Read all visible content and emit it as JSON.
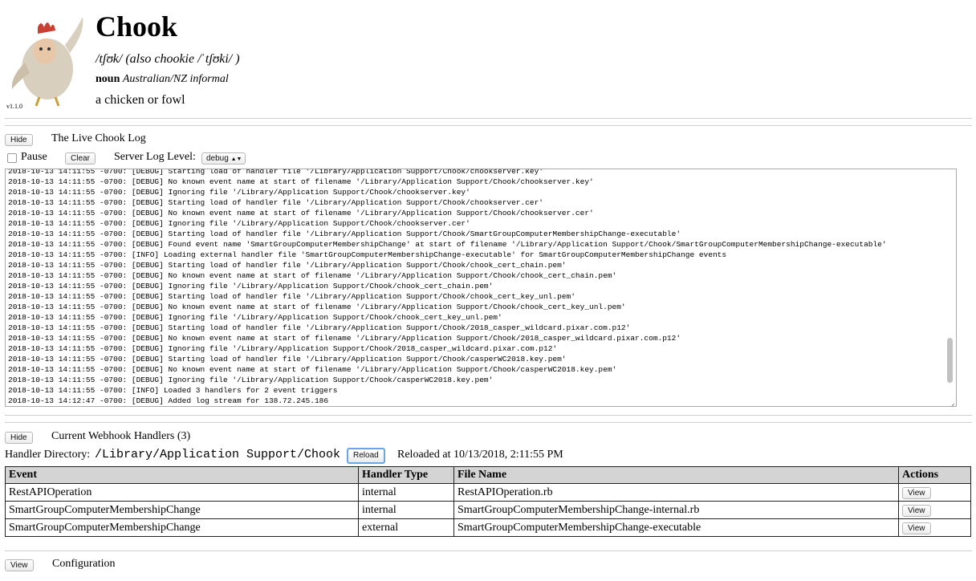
{
  "header": {
    "title": "Chook",
    "pronunciation": "/tʃʊk/ (also chookie /ˈtʃʊki/ )",
    "pos": "noun",
    "usage": "Australian/NZ informal",
    "definition": "a chicken or fowl",
    "version": "v1.1.0"
  },
  "live_log": {
    "hide_label": "Hide",
    "title": "The Live Chook Log",
    "pause_label": "Pause",
    "clear_label": "Clear",
    "level_label": "Server Log Level:",
    "level_value": "debug",
    "lines": [
      "2018-10-13 14:11:55 -0700: [DEBUG] Starting load of handler file '/Library/Application Support/Chook/chookserver.key'",
      "2018-10-13 14:11:55 -0700: [DEBUG] No known event name at start of filename '/Library/Application Support/Chook/chookserver.key'",
      "2018-10-13 14:11:55 -0700: [DEBUG] Ignoring file '/Library/Application Support/Chook/chookserver.key'",
      "2018-10-13 14:11:55 -0700: [DEBUG] Starting load of handler file '/Library/Application Support/Chook/chookserver.cer'",
      "2018-10-13 14:11:55 -0700: [DEBUG] No known event name at start of filename '/Library/Application Support/Chook/chookserver.cer'",
      "2018-10-13 14:11:55 -0700: [DEBUG] Ignoring file '/Library/Application Support/Chook/chookserver.cer'",
      "2018-10-13 14:11:55 -0700: [DEBUG] Starting load of handler file '/Library/Application Support/Chook/SmartGroupComputerMembershipChange-executable'",
      "2018-10-13 14:11:55 -0700: [DEBUG] Found event name 'SmartGroupComputerMembershipChange' at start of filename '/Library/Application Support/Chook/SmartGroupComputerMembershipChange-executable'",
      "2018-10-13 14:11:55 -0700: [INFO] Loading external handler file 'SmartGroupComputerMembershipChange-executable' for SmartGroupComputerMembershipChange events",
      "2018-10-13 14:11:55 -0700: [DEBUG] Starting load of handler file '/Library/Application Support/Chook/chook_cert_chain.pem'",
      "2018-10-13 14:11:55 -0700: [DEBUG] No known event name at start of filename '/Library/Application Support/Chook/chook_cert_chain.pem'",
      "2018-10-13 14:11:55 -0700: [DEBUG] Ignoring file '/Library/Application Support/Chook/chook_cert_chain.pem'",
      "2018-10-13 14:11:55 -0700: [DEBUG] Starting load of handler file '/Library/Application Support/Chook/chook_cert_key_unl.pem'",
      "2018-10-13 14:11:55 -0700: [DEBUG] No known event name at start of filename '/Library/Application Support/Chook/chook_cert_key_unl.pem'",
      "2018-10-13 14:11:55 -0700: [DEBUG] Ignoring file '/Library/Application Support/Chook/chook_cert_key_unl.pem'",
      "2018-10-13 14:11:55 -0700: [DEBUG] Starting load of handler file '/Library/Application Support/Chook/2018_casper_wildcard.pixar.com.p12'",
      "2018-10-13 14:11:55 -0700: [DEBUG] No known event name at start of filename '/Library/Application Support/Chook/2018_casper_wildcard.pixar.com.p12'",
      "2018-10-13 14:11:55 -0700: [DEBUG] Ignoring file '/Library/Application Support/Chook/2018_casper_wildcard.pixar.com.p12'",
      "2018-10-13 14:11:55 -0700: [DEBUG] Starting load of handler file '/Library/Application Support/Chook/casperWC2018.key.pem'",
      "2018-10-13 14:11:55 -0700: [DEBUG] No known event name at start of filename '/Library/Application Support/Chook/casperWC2018.key.pem'",
      "2018-10-13 14:11:55 -0700: [DEBUG] Ignoring file '/Library/Application Support/Chook/casperWC2018.key.pem'",
      "2018-10-13 14:11:55 -0700: [INFO] Loaded 3 handlers for 2 event triggers",
      "2018-10-13 14:12:47 -0700: [DEBUG] Added log stream for 138.72.245.186"
    ]
  },
  "handlers": {
    "hide_label": "Hide",
    "title": "Current Webhook Handlers (3)",
    "dir_label": "Handler Directory:",
    "dir_value": "/Library/Application Support/Chook",
    "reload_label": "Reload",
    "reloaded_text": "Reloaded at 10/13/2018, 2:11:55 PM",
    "columns": [
      "Event",
      "Handler Type",
      "File Name",
      "Actions"
    ],
    "rows": [
      {
        "event": "RestAPIOperation",
        "type": "internal",
        "file": "RestAPIOperation.rb",
        "action": "View"
      },
      {
        "event": "SmartGroupComputerMembershipChange",
        "type": "internal",
        "file": "SmartGroupComputerMembershipChange-internal.rb",
        "action": "View"
      },
      {
        "event": "SmartGroupComputerMembershipChange",
        "type": "external",
        "file": "SmartGroupComputerMembershipChange-executable",
        "action": "View"
      }
    ]
  },
  "config": {
    "view_label": "View",
    "title": "Configuration"
  }
}
